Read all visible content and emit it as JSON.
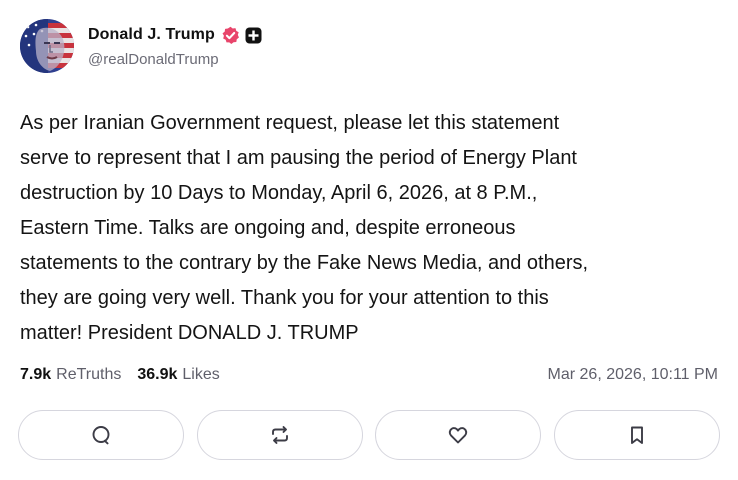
{
  "author": {
    "display_name": "Donald J. Trump",
    "handle": "@realDonaldTrump",
    "avatar_icon": "flag-portrait-avatar",
    "verified_icon": "verified-badge-icon",
    "verified_color": "#e8456b",
    "plus_icon": "plus-badge-icon"
  },
  "post": {
    "text": "As per Iranian Government request, please let this statement\nserve to represent that I am pausing the period of Energy Plant\ndestruction by 10 Days to Monday, April 6, 2026, at 8 P.M.,\nEastern Time. Talks are ongoing and, despite erroneous\nstatements to the contrary by the Fake News Media, and others,\nthey are going very well. Thank you for your attention to this\nmatter! President DONALD J. TRUMP"
  },
  "stats": {
    "retruths_count": "7.9k",
    "retruths_label": "ReTruths",
    "likes_count": "36.9k",
    "likes_label": "Likes",
    "timestamp": "Mar 26, 2026, 10:11 PM"
  },
  "actions": [
    {
      "icon": "reply-icon"
    },
    {
      "icon": "retruth-icon"
    },
    {
      "icon": "like-heart-icon"
    },
    {
      "icon": "bookmark-icon"
    }
  ]
}
